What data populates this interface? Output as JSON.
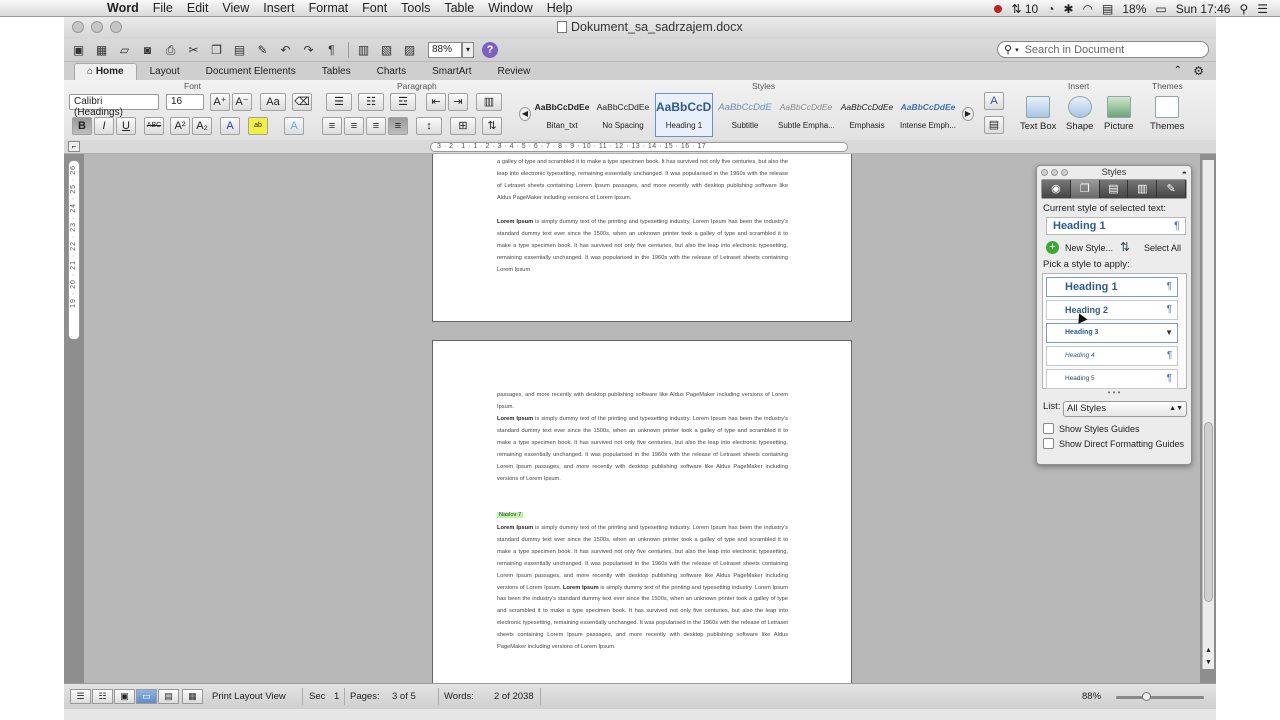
{
  "menubar": {
    "app_name": "Word",
    "menus": [
      "File",
      "Edit",
      "View",
      "Insert",
      "Format",
      "Font",
      "Tools",
      "Table",
      "Window",
      "Help"
    ],
    "status": {
      "sync_count": "10",
      "battery": "18%",
      "clock": "Sun 17:46"
    }
  },
  "window": {
    "title": "Dokument_sa_sadrzajem.docx",
    "zoom": "88%",
    "search_placeholder": "Search in Document"
  },
  "ribbon": {
    "tabs": [
      "Home",
      "Layout",
      "Document Elements",
      "Tables",
      "Charts",
      "SmartArt",
      "Review"
    ],
    "active_tab": "Home",
    "groups": {
      "font": "Font",
      "paragraph": "Paragraph",
      "styles": "Styles",
      "insert": "Insert",
      "themes": "Themes"
    },
    "font_name": "Calibri (Headings)",
    "font_size": "16",
    "style_gallery": [
      {
        "sample": "AaBbCcDdEe",
        "name": "Bitan_txt"
      },
      {
        "sample": "AaBbCcDdEe",
        "name": "No Spacing"
      },
      {
        "sample": "AaBbCcDd",
        "name": "Heading 1"
      },
      {
        "sample": "AaBbCcDdE",
        "name": "Subtitle"
      },
      {
        "sample": "AaBbCcDdEe",
        "name": "Subtle Empha..."
      },
      {
        "sample": "AaBbCcDdEe",
        "name": "Emphasis"
      },
      {
        "sample": "AaBbCcDdEe",
        "name": "Intense Emph..."
      }
    ],
    "insert_buttons": [
      "Text Box",
      "Shape",
      "Picture"
    ],
    "themes_button": "Themes"
  },
  "document": {
    "page1_text": "a galley of type and scrambled it to make a type specimen book. It has survived not only five centuries, but also the leap into electronic typesetting, remaining essentially unchanged. It was popularised in the 1960s with the release of Letraset sheets containing Lorem Ipsum passages, and more recently with desktop publishing software like Aldus PageMaker including versions of Lorem Ipsum.",
    "page1_bold": "Lorem Ipsum",
    "page1_text2": " is simply dummy text of the printing and typesetting industry. Lorem Ipsum has been the industry's standard dummy text ever since the 1500s, when an unknown printer took a galley of type and scrambled it to make a type specimen book. It has survived not only five centuries, but also the leap into electronic typesetting, remaining essentially unchanged. It was popularised in the 1960s with the release of Letraset sheets containing Lorem Ipsum",
    "page2_text": "passages, and more recently with desktop publishing software like Aldus PageMaker including versions of Lorem Ipsum.",
    "page2_bold": "Lorem Ipsum",
    "page2_text2": " is simply dummy text of the printing and typesetting industry. Lorem Ipsum has been the industry's standard dummy text ever since the 1500s, when an unknown printer took a galley of type and scrambled it to make a type specimen book. It has survived not only five centuries, but also the leap into electronic typesetting, remaining essentially unchanged. It was popularised in the 1960s with the release of Letraset sheets containing Lorem Ipsum passages, and more recently with desktop publishing software like Aldus PageMaker including versions of Lorem Ipsum.",
    "heading": "Naslov 7",
    "page2_bold2": "Lorem Ipsum",
    "page2_text3": " is simply dummy text of the printing and typesetting industry. Lorem Ipsum has been the industry's standard dummy text ever since the 1500s, when an unknown printer took a galley of type and scrambled it to make a type specimen book. It has survived not only five centuries, but also the leap into electronic typesetting, remaining essentially unchanged. It was popularised in the 1960s with the release of Letraset sheets containing Lorem Ipsum passages, and more recently with desktop publishing software like Aldus PageMaker including versions of Lorem Ipsum. ",
    "page2_bold3": "Lorem Ipsum",
    "page2_text4": " is simply dummy text of the printing and typesetting industry. Lorem Ipsum has been the industry's standard dummy text ever since the 1500s, when an unknown printer took a galley of type and scrambled it to make a type specimen book. It has survived not only five centuries, but also the leap into electronic typesetting, remaining essentially unchanged. It was popularised in the 1960s with the release of Letraset sheets containing Lorem Ipsum passages, and more recently with desktop publishing software like Aldus PageMaker including versions of Lorem Ipsum.",
    "hruler_ticks": "3 · 2 · 1 · 1 · 2 · 3 · 4 · 5 · 6 · 7 · 8 · 9 · 10 · 11 · 12 · 13 · 14 · 15 · 16 · 17",
    "vruler_ticks": "19 · 20 · 21 · 22 · 23 · 24 · 25 · 26"
  },
  "statusbar": {
    "view_name": "Print Layout View",
    "sec_label": "Sec",
    "sec_value": "1",
    "pages_label": "Pages:",
    "pages_value": "3 of 5",
    "words_label": "Words:",
    "words_value": "2 of 2038",
    "zoom": "88%"
  },
  "styles_palette": {
    "title": "Styles",
    "current_label": "Current style of selected text:",
    "current_style": "Heading 1",
    "new_style": "New Style...",
    "select_all": "Select All",
    "pick_label": "Pick a style to apply:",
    "items": [
      "Heading 1",
      "Heading 2",
      "Heading 3",
      "Heading 4",
      "Heading 5"
    ],
    "list_label": "List:",
    "list_value": "All Styles",
    "show_guides": "Show Styles Guides",
    "show_direct": "Show Direct Formatting Guides"
  },
  "colors": {
    "accent": "#2f5a93",
    "heading_highlight": "#b9f5a4"
  }
}
